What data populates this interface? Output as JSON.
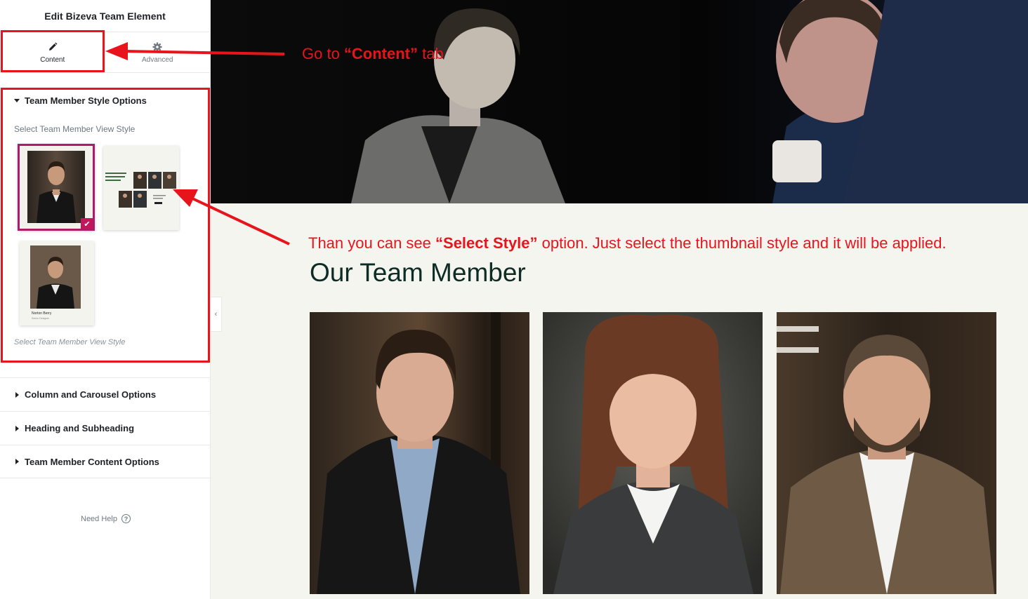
{
  "sidebar": {
    "title": "Edit Bizeva Team Element",
    "tabs": [
      {
        "label": "Content",
        "icon": "pencil-icon"
      },
      {
        "label": "Advanced",
        "icon": "gear-icon"
      }
    ],
    "open_section": {
      "title": "Team Member Style Options",
      "field_label": "Select Team Member View Style",
      "help_text": "Select Team Member View Style",
      "styles": [
        {
          "id": "style-1",
          "selected": true
        },
        {
          "id": "style-2",
          "selected": false,
          "heading": "Thinkers, builders, and creators driven by impact"
        },
        {
          "id": "style-3",
          "selected": false,
          "name": "Norton Berry",
          "role": "Senior Designer"
        }
      ]
    },
    "sections": [
      {
        "title": "Column and Carousel Options"
      },
      {
        "title": "Heading and Subheading"
      },
      {
        "title": "Team Member Content Options"
      }
    ],
    "need_help": "Need Help",
    "collapse_icon": "‹"
  },
  "annotations": {
    "tab_note_pre": "Go  to ",
    "tab_note_bold": "“Content”",
    "tab_note_post": " tab",
    "style_note_pre": "Than you can see ",
    "style_note_bold": "“Select Style”",
    "style_note_post": " option. Just select the thumbnail style and it will be applied."
  },
  "preview": {
    "heading": "Our Team Member"
  },
  "colors": {
    "accent_red": "#e8141c",
    "selected_border": "#b01a6a",
    "heading_green": "#0f2b25",
    "preview_bg": "#f5f5f0"
  }
}
